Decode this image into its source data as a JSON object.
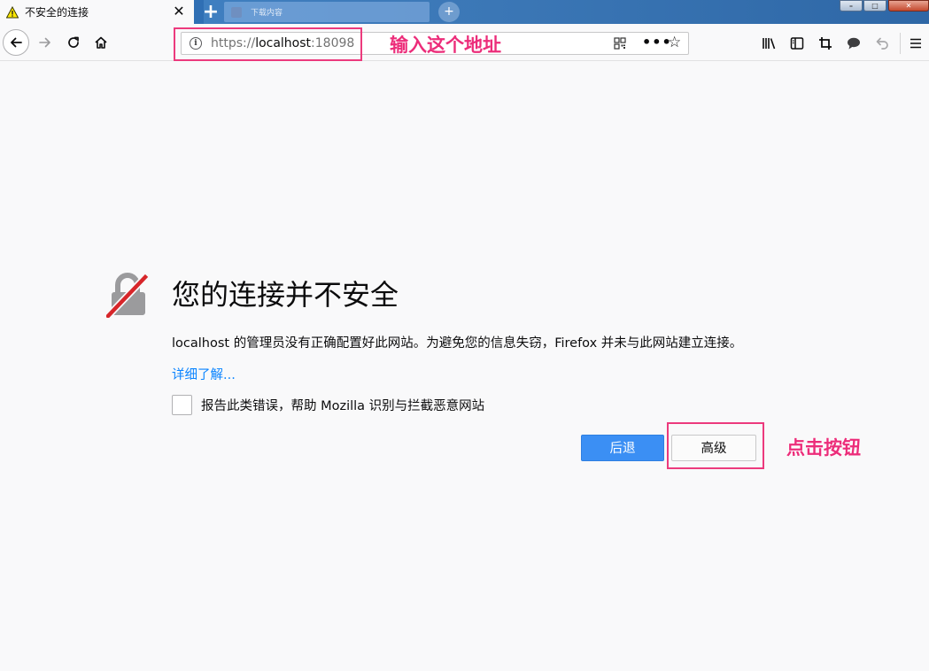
{
  "tabs": {
    "active_title": "不安全的连接",
    "close_glyph": "✕",
    "new_tab_glyph": "+",
    "background_tab_title": "下载内容"
  },
  "window_controls": {
    "minimize": "–",
    "maximize": "□",
    "close": "✕"
  },
  "urlbar": {
    "scheme": "https://",
    "host": "localhost",
    "port": ":18098",
    "info_glyph": "i",
    "more_glyph": "•••",
    "star_glyph": "☆"
  },
  "annotations": {
    "url_note": "输入这个地址",
    "button_note": "点击按钮",
    "highlight_color": "#ec3a7d"
  },
  "error_page": {
    "title": "您的连接并不安全",
    "description": "localhost 的管理员没有正确配置好此网站。为避免您的信息失窃，Firefox 并未与此网站建立连接。",
    "learn_more": "详细了解...",
    "report_label": "报告此类错误，帮助 Mozilla 识别与拦截恶意网站",
    "back_button": "后退",
    "advanced_button": "高级",
    "accent_color": "#3b8ff4",
    "lock_slash_color": "#d7262a"
  },
  "icons": {
    "tab_warning": "warning-icon",
    "back": "back-arrow-icon",
    "forward": "forward-arrow-icon",
    "reload": "reload-icon",
    "home": "home-icon",
    "library": "library-icon",
    "sidebar": "sidebar-icon",
    "screenshot": "screenshot-icon",
    "chat": "chat-icon",
    "undo": "undo-icon",
    "menu": "hamburger-menu-icon"
  }
}
